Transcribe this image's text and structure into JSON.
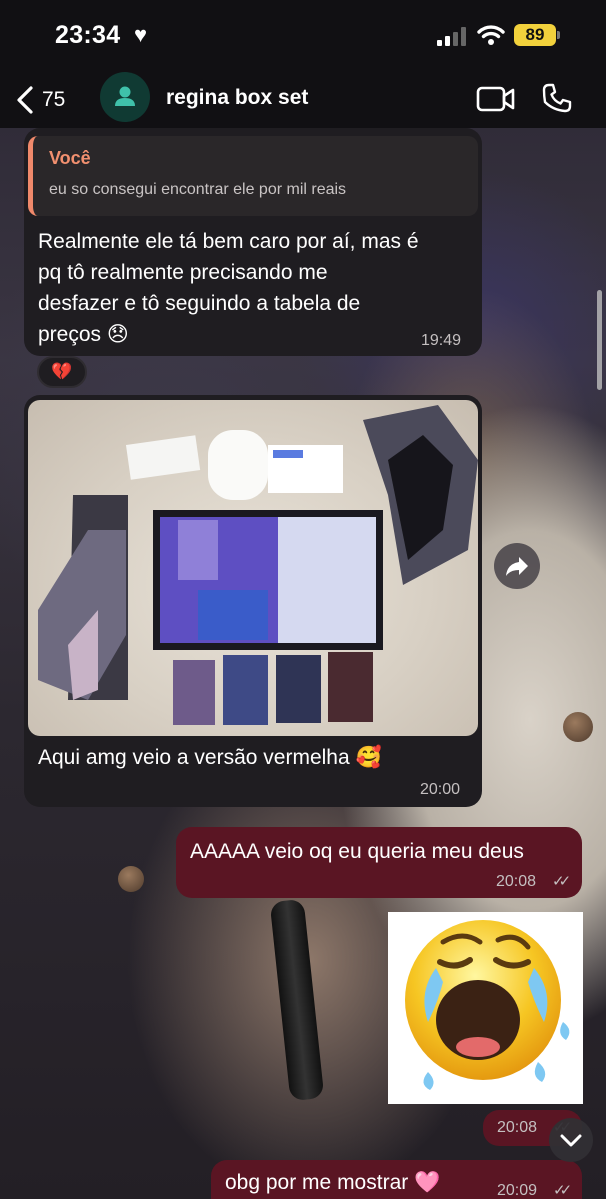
{
  "status_bar": {
    "time": "23:34",
    "battery": "89"
  },
  "header": {
    "back_count": "75",
    "title": "regina box set"
  },
  "messages": {
    "reply": {
      "quote_author": "Você",
      "quote_text": "eu so consegui encontrar ele por mil reais",
      "lines": [
        "Realmente ele tá bem caro por aí, mas é",
        "pq tô realmente precisando me",
        "desfazer e tô seguindo a tabela de",
        "preços 😞"
      ],
      "time": "19:49",
      "reaction": "💔"
    },
    "photo_message": {
      "caption": "Aqui amg veio a versão vermelha 🥰",
      "time": "20:00"
    },
    "out1": {
      "text": "AAAAA veio oq eu queria meu deus",
      "time": "20:08"
    },
    "sticker": {
      "time": "20:08"
    },
    "out2": {
      "text": "obg por me mostrar 🩷",
      "time": "20:09"
    }
  },
  "colors": {
    "incoming_bubble": "#1f1d21",
    "outgoing_bubble": "#5a1523",
    "quote_accent": "#f0896b",
    "battery": "#f2d13c"
  },
  "icons": [
    "heart-icon",
    "signal-icon",
    "wifi-icon",
    "back-chevron-icon",
    "user-icon",
    "video-call-icon",
    "phone-icon",
    "forward-icon",
    "chevron-down-icon",
    "read-ticks-icon"
  ]
}
